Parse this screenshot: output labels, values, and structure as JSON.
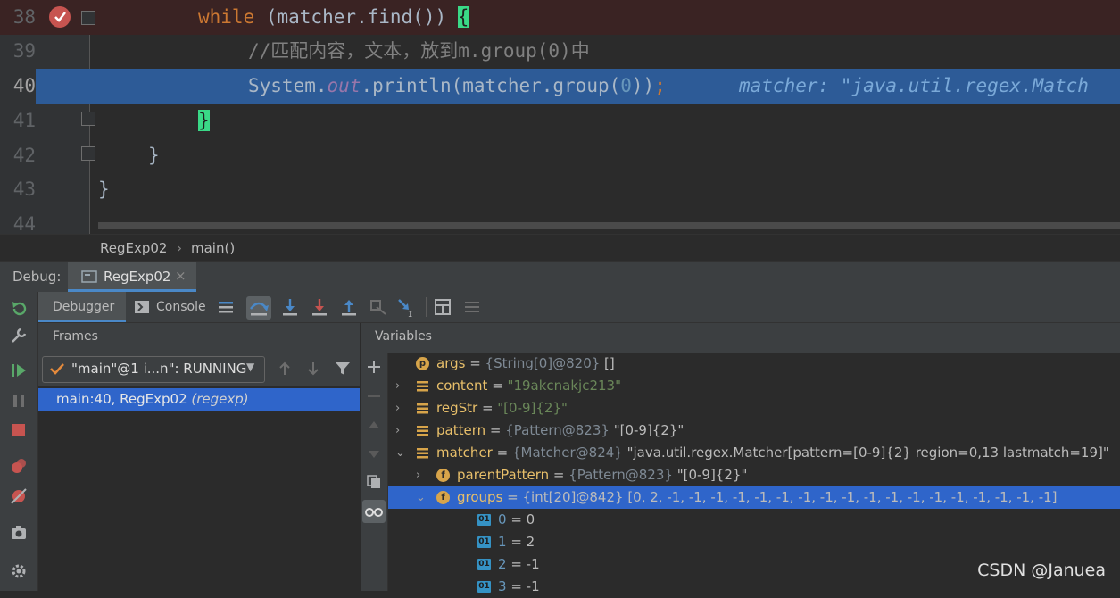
{
  "editor": {
    "lines": [
      {
        "num": "38",
        "parts": [
          {
            "t": "while",
            "c": "kw"
          },
          {
            "t": " (matcher.find()) ",
            "c": ""
          },
          {
            "t": "{",
            "c": "brace-hl"
          }
        ]
      },
      {
        "num": "39",
        "parts": [
          {
            "t": "//匹配内容，文本，放到m.group(0)中",
            "c": "cmt"
          }
        ]
      },
      {
        "num": "40",
        "parts": [
          {
            "t": "System.",
            "c": ""
          },
          {
            "t": "out",
            "c": "fld"
          },
          {
            "t": ".println(matcher.group(",
            "c": ""
          },
          {
            "t": "0",
            "c": "num"
          },
          {
            "t": "))",
            "c": ""
          },
          {
            "t": ";",
            "c": "kw"
          }
        ]
      },
      {
        "num": "41",
        "parts": [
          {
            "t": "}",
            "c": "brace-hl"
          }
        ]
      },
      {
        "num": "42",
        "parts": [
          {
            "t": "}",
            "c": ""
          }
        ]
      },
      {
        "num": "43",
        "parts": [
          {
            "t": "}",
            "c": ""
          }
        ]
      },
      {
        "num": "44",
        "parts": []
      }
    ],
    "inline_hint": "matcher: \"java.util.regex.Match"
  },
  "breadcrumb": {
    "class": "RegExp02",
    "sep": "›",
    "method": "main()"
  },
  "debug": {
    "label": "Debug:",
    "tab": "RegExp02",
    "tab_close": "×",
    "subtabs": {
      "debugger": "Debugger",
      "console": "Console"
    }
  },
  "frames": {
    "title": "Frames",
    "thread": "\"main\"@1 i...n\": RUNNING",
    "selected_frame": "main:40, RegExp02",
    "selected_frame_pkg": "(regexp)"
  },
  "variables": {
    "title": "Variables",
    "rows": [
      {
        "icon": "p",
        "arrow": "",
        "name": "args",
        "type": "{String[0]@820}",
        "value": " []",
        "vclass": "vplain"
      },
      {
        "icon": "eq",
        "arrow": "›",
        "name": "content",
        "type": "",
        "value": "\"19akcnakjc213\"",
        "vclass": "vstr"
      },
      {
        "icon": "eq",
        "arrow": "›",
        "name": "regStr",
        "type": "",
        "value": "\"[0-9]{2}\"",
        "vclass": "vstr"
      },
      {
        "icon": "eq",
        "arrow": "›",
        "name": "pattern",
        "type": "{Pattern@823}",
        "value": " \"[0-9]{2}\"",
        "vclass": "vplain"
      },
      {
        "icon": "eq",
        "arrow": "⌄",
        "name": "matcher",
        "type": "{Matcher@824}",
        "value": " \"java.util.regex.Matcher[pattern=[0-9]{2} region=0,13 lastmatch=19]\"",
        "vclass": "vplain"
      },
      {
        "icon": "f",
        "arrow": "›",
        "name": "parentPattern",
        "type": "{Pattern@823}",
        "value": " \"[0-9]{2}\"",
        "vclass": "vplain",
        "indent": 1
      },
      {
        "icon": "f",
        "arrow": "⌄",
        "name": "groups",
        "type": "",
        "value": "{int[20]@842} [0, 2, -1, -1, -1, -1, -1, -1, -1, -1, -1, -1, -1, -1, -1, -1, -1, -1, -1, -1]",
        "vclass": "vplain",
        "indent": 1,
        "selected": true
      },
      {
        "icon": "num",
        "arrow": "",
        "name": "0",
        "type": "",
        "value": "0",
        "vclass": "vplain",
        "indent": 2
      },
      {
        "icon": "num",
        "arrow": "",
        "name": "1",
        "type": "",
        "value": "2",
        "vclass": "vplain",
        "indent": 2
      },
      {
        "icon": "num",
        "arrow": "",
        "name": "2",
        "type": "",
        "value": "-1",
        "vclass": "vplain",
        "indent": 2
      },
      {
        "icon": "num",
        "arrow": "",
        "name": "3",
        "type": "",
        "value": "-1",
        "vclass": "vplain",
        "indent": 2
      }
    ]
  },
  "watermark": "CSDN @Januea",
  "colors": {
    "accent": "#4a88c7",
    "selection": "#2f65ca",
    "breakpoint": "#c75450",
    "brace_highlight": "#3ad987"
  }
}
